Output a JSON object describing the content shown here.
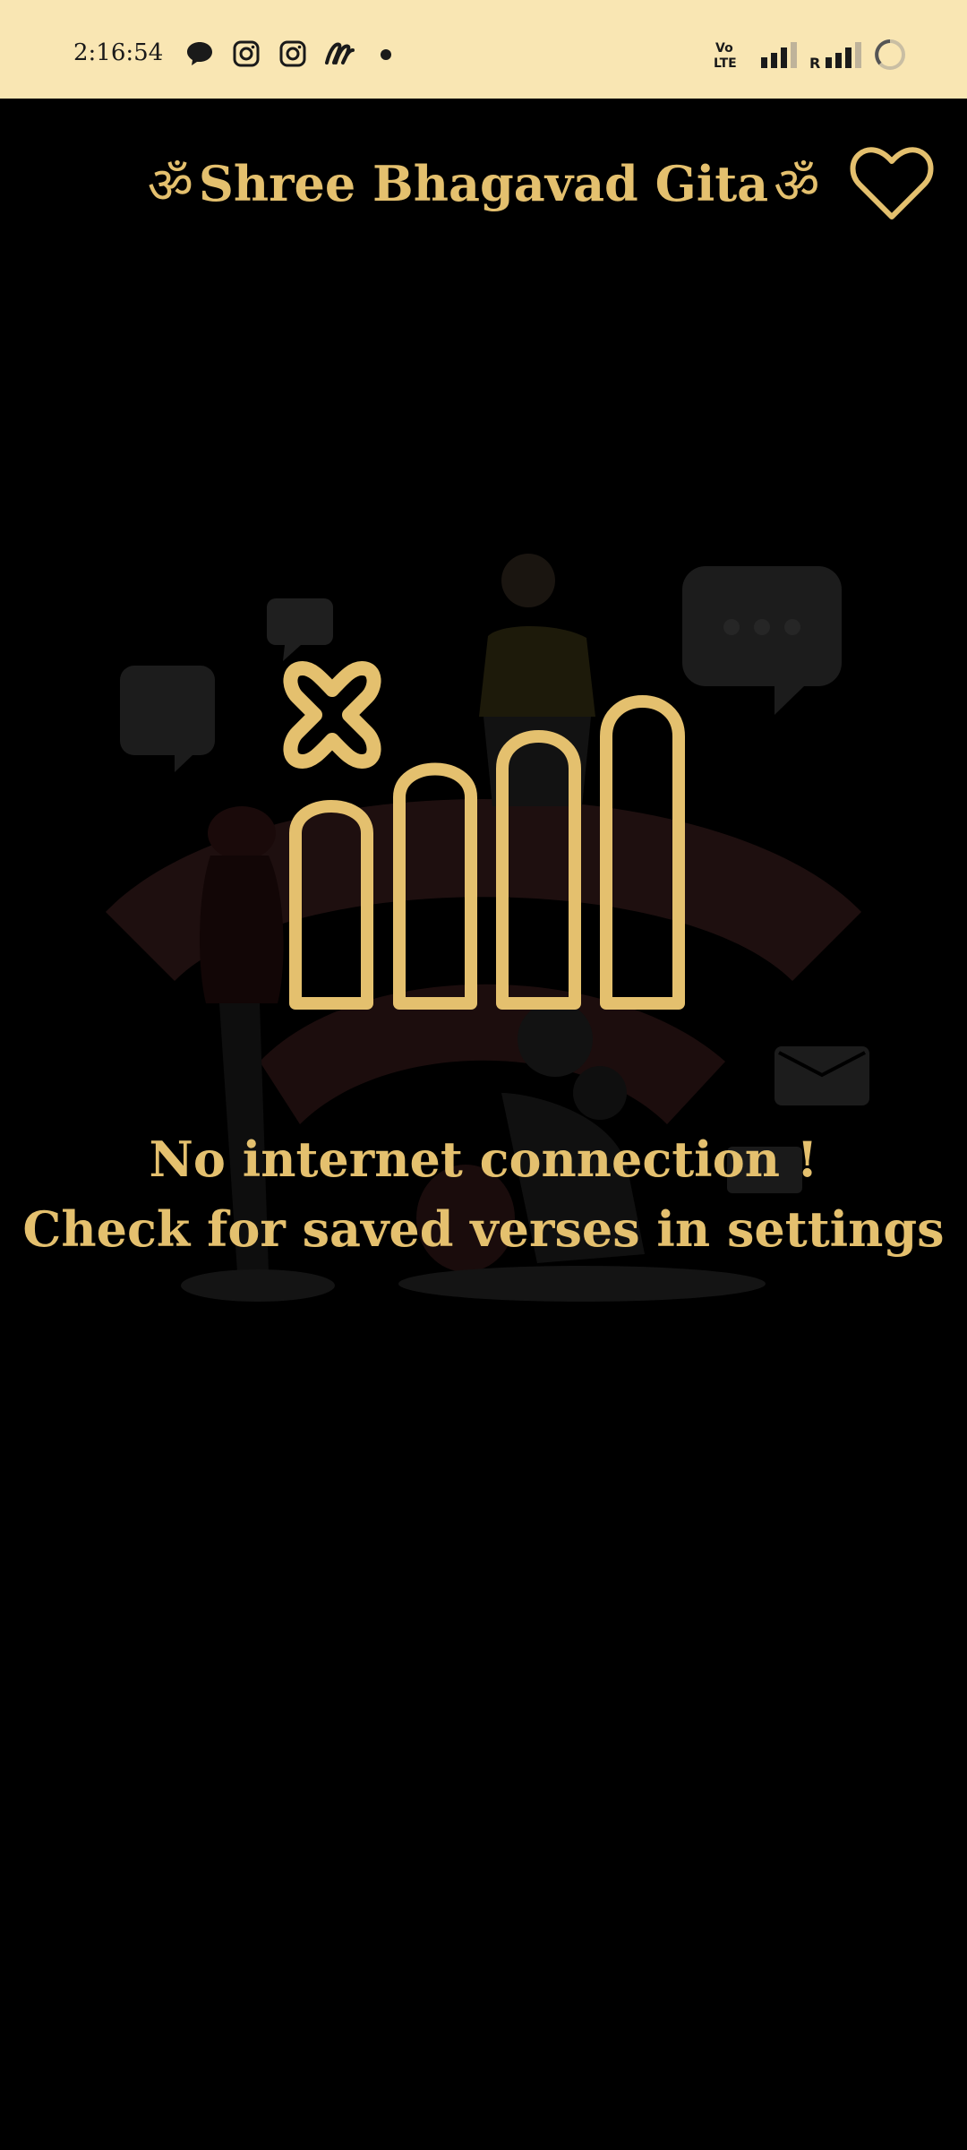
{
  "status_bar": {
    "time": "2:16:54",
    "icons": [
      "chat-bubble-icon",
      "instagram-icon",
      "instagram-icon",
      "app-logo-icon",
      "dot-icon"
    ],
    "network_label_1": "Vo\nLTE",
    "roaming_label": "R"
  },
  "header": {
    "om_left": "ॐ",
    "title": "Shree Bhagavad Gita",
    "om_right": "ॐ",
    "favorite_icon": "heart-icon"
  },
  "message": {
    "line1": "No internet connection !",
    "line2": "Check for saved verses in settings"
  },
  "colors": {
    "accent": "#e4c06e",
    "status_bar_bg": "#f9e6b3",
    "background": "#000000"
  }
}
